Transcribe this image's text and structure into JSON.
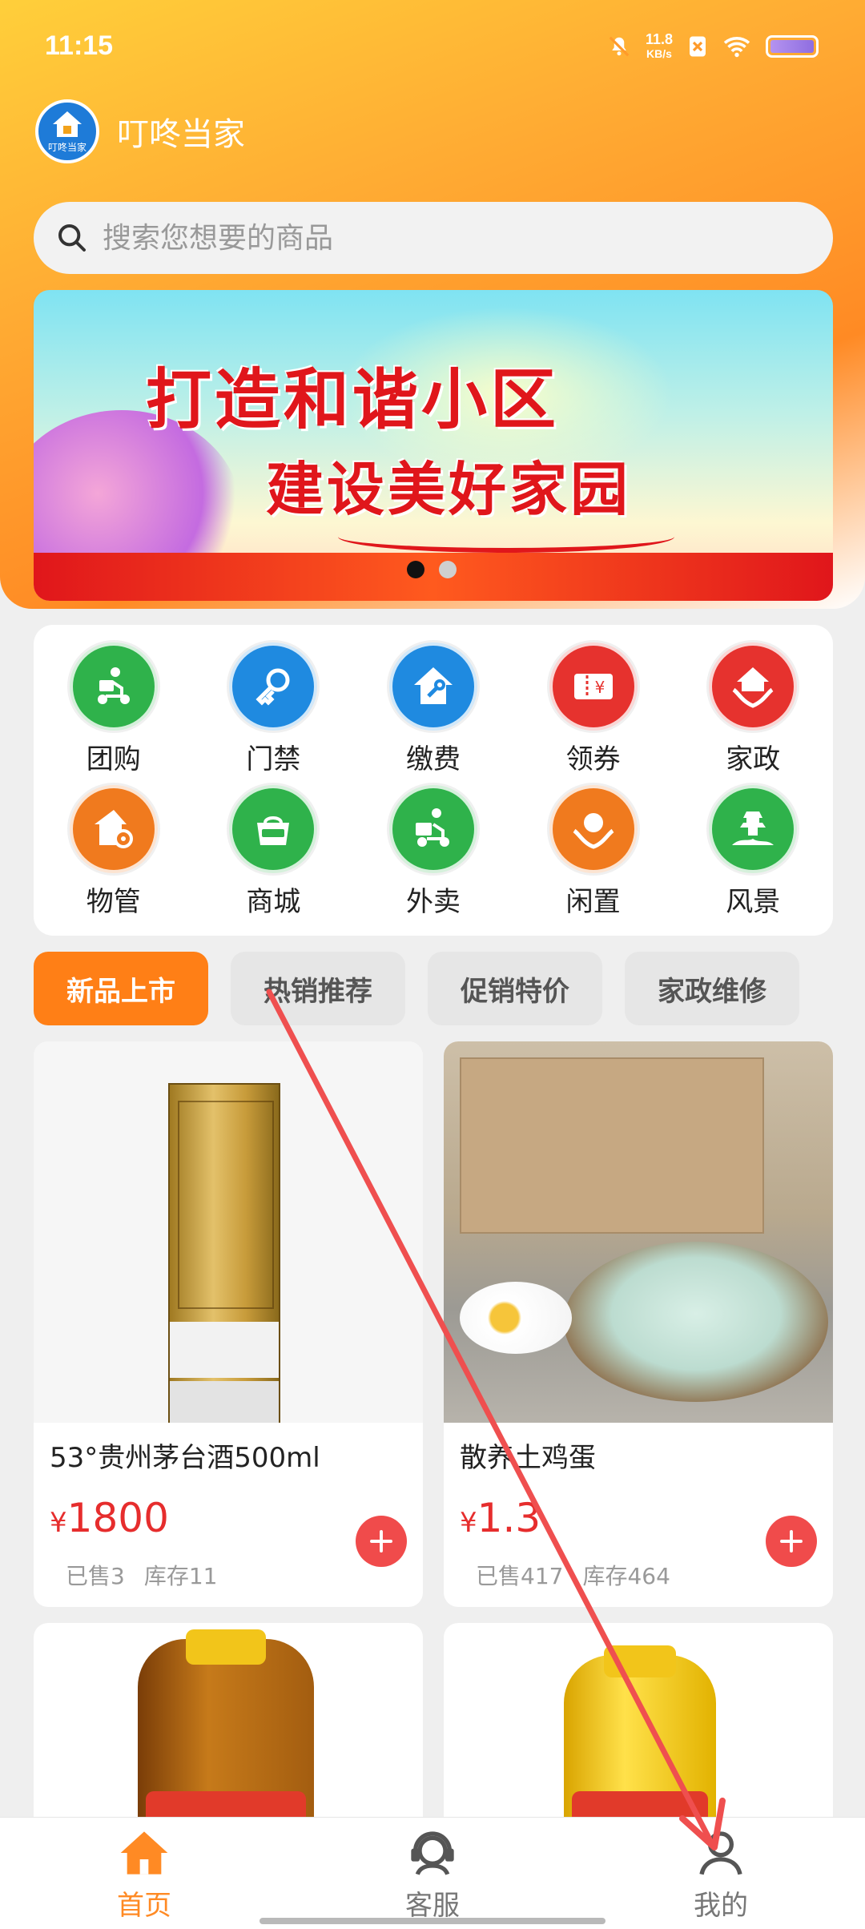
{
  "status_bar": {
    "time": "11:15",
    "net_speed": "11.8",
    "net_unit": "KB/s"
  },
  "header": {
    "app_name": "叮咚当家",
    "logo_text": "叮咚当家"
  },
  "search": {
    "placeholder": "搜索您想要的商品"
  },
  "banner": {
    "line1": "打造和谐小区",
    "line2": "建设美好家园",
    "slides": 2,
    "active_slide": 0
  },
  "services": [
    {
      "label": "团购",
      "icon": "delivery-scooter-icon",
      "color": "#2fb24b"
    },
    {
      "label": "门禁",
      "icon": "key-icon",
      "color": "#1f8ae0"
    },
    {
      "label": "缴费",
      "icon": "home-wrench-icon",
      "color": "#1f8ae0"
    },
    {
      "label": "领券",
      "icon": "coupon-icon",
      "color": "#e6322e"
    },
    {
      "label": "家政",
      "icon": "home-hands-icon",
      "color": "#e6322e"
    },
    {
      "label": "物管",
      "icon": "property-gear-icon",
      "color": "#f07a1e"
    },
    {
      "label": "商城",
      "icon": "farm-shop-icon",
      "color": "#2fb24b"
    },
    {
      "label": "外卖",
      "icon": "takeout-scooter-icon",
      "color": "#2fb24b"
    },
    {
      "label": "闲置",
      "icon": "hands-support-icon",
      "color": "#f07a1e"
    },
    {
      "label": "风景",
      "icon": "pagoda-icon",
      "color": "#2fb24b"
    }
  ],
  "category_tabs": [
    "新品上市",
    "热销推荐",
    "促销特价",
    "家政维修"
  ],
  "products": [
    {
      "name": "53°贵州茅台酒500ml",
      "currency": "¥",
      "price": "1800",
      "sold": "已售3",
      "stock": "库存11"
    },
    {
      "name": "散养土鸡蛋",
      "currency": "¥",
      "price": "1.3",
      "sold": "已售417",
      "stock": "库存464"
    }
  ],
  "bottom_nav": [
    {
      "label": "首页",
      "icon": "home-icon",
      "active": true
    },
    {
      "label": "客服",
      "icon": "customer-service-icon",
      "active": false
    },
    {
      "label": "我的",
      "icon": "user-profile-icon",
      "active": false
    }
  ],
  "colors": {
    "accent": "#ff8a24",
    "price": "#e62d2d",
    "tab_active": "#ff7f16"
  }
}
